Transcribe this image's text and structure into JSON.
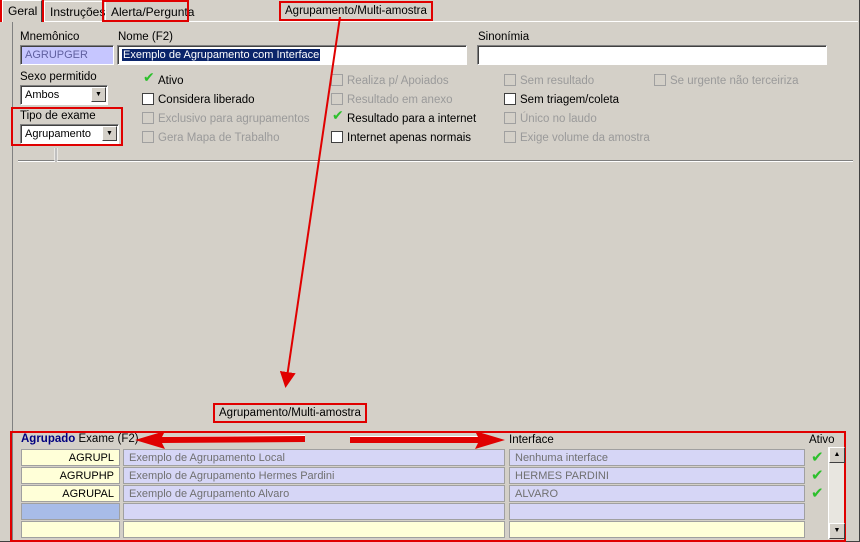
{
  "tabs": [
    {
      "label": "Geral"
    },
    {
      "label": "Instruções"
    },
    {
      "label": "Alerta/Pergunta"
    }
  ],
  "callouts": {
    "top": "Agrupamento/Multi-amostra",
    "middle": "Agrupamento/Multi-amostra"
  },
  "fields": {
    "mnemonico_label": "Mnemônico",
    "mnemonico_value": "AGRUPGER",
    "nome_label": "Nome (F2)",
    "nome_value": "Exemplo de Agrupamento com Interface",
    "sinonimia_label": "Sinonímia",
    "sinonimia_value": "",
    "sexo_label": "Sexo permitido",
    "sexo_value": "Ambos",
    "tipo_label": "Tipo de exame",
    "tipo_value": "Agrupamento"
  },
  "checkboxes": {
    "col1": [
      {
        "label": "Ativo",
        "checked": true,
        "enabled": true
      },
      {
        "label": "Considera liberado",
        "checked": false,
        "enabled": true
      },
      {
        "label": "Exclusivo para agrupamentos",
        "checked": false,
        "enabled": false
      },
      {
        "label": "Gera Mapa de Trabalho",
        "checked": false,
        "enabled": false
      }
    ],
    "col2": [
      {
        "label": "Realiza p/ Apoiados",
        "checked": false,
        "enabled": false
      },
      {
        "label": "Resultado em anexo",
        "checked": false,
        "enabled": false
      },
      {
        "label": "Resultado para a internet",
        "checked": true,
        "enabled": true
      },
      {
        "label": "Internet apenas normais",
        "checked": false,
        "enabled": true
      }
    ],
    "col3": [
      {
        "label": "Sem resultado",
        "checked": false,
        "enabled": false
      },
      {
        "label": "Sem triagem/coleta",
        "checked": false,
        "enabled": true
      },
      {
        "label": "Único no laudo",
        "checked": false,
        "enabled": false
      },
      {
        "label": "Exige volume da amostra",
        "checked": false,
        "enabled": false
      }
    ],
    "col4": [
      {
        "label": "Se urgente não terceiriza",
        "checked": false,
        "enabled": false
      }
    ]
  },
  "grid": {
    "header_agrupado": "Agrupado",
    "header_exame": "Exame (F2)",
    "header_interface": "Interface",
    "header_ativo": "Ativo",
    "rows": [
      {
        "code": "AGRUPL",
        "desc": "Exemplo de Agrupamento Local",
        "interface": "Nenhuma interface",
        "ativo": true
      },
      {
        "code": "AGRUPHP",
        "desc": "Exemplo de Agrupamento Hermes Pardini",
        "interface": "HERMES PARDINI",
        "ativo": true
      },
      {
        "code": "AGRUPAL",
        "desc": "Exemplo de Agrupamento Alvaro",
        "interface": "ALVARO",
        "ativo": true
      }
    ]
  },
  "colors": {
    "highlight": "#e00000",
    "check": "#2cc02c",
    "readonly_bg": "#c6c6ff"
  }
}
